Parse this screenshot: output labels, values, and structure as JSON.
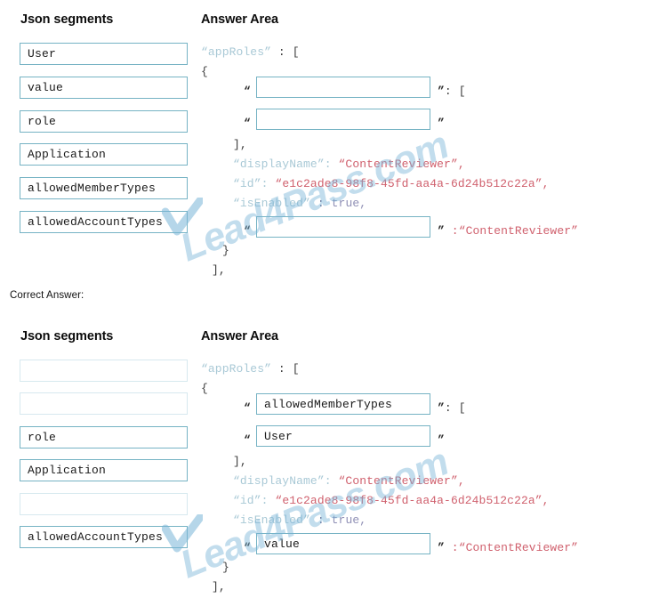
{
  "watermark": {
    "text": "Lead4Pass.com"
  },
  "question_panel": {
    "segments_heading": "Json segments",
    "answer_heading": "Answer Area",
    "segments": [
      {
        "label": "User",
        "used": false
      },
      {
        "label": "value",
        "used": false
      },
      {
        "label": "role",
        "used": false
      },
      {
        "label": "Application",
        "used": false
      },
      {
        "label": "allowedMemberTypes",
        "used": false
      },
      {
        "label": "allowedAccountTypes",
        "used": false
      }
    ],
    "code": {
      "line_approles_key": "“appRoles”",
      "line_approles_rest": " : [",
      "line_open_brace": "{",
      "quote_left_1": "“",
      "quote_right_1": "”",
      "after_quote_1": ": [",
      "quote_left_2": "“",
      "quote_right_2": "”",
      "line_close_array": "],",
      "displayname_key": "“displayName”:",
      "displayname_value": "“ContentReviewer”,",
      "id_key": "“id”:",
      "id_value": "“e1c2ade8-98f8-45fd-aa4a-6d24b512c22a”,",
      "isenabled_key": "“isEnabled”",
      "isenabled_colon": " : ",
      "isenabled_value": "true,",
      "quote_left_3": "“",
      "quote_right_3": "”",
      "value_tail": " :“ContentReviewer”",
      "line_close_brace": "}",
      "line_close_outer": "],"
    },
    "drop_boxes": [
      {
        "value": ""
      },
      {
        "value": ""
      },
      {
        "value": ""
      }
    ]
  },
  "answer_panel": {
    "correct_answer_label": "Correct Answer:",
    "segments_heading": "Json segments",
    "answer_heading": "Answer Area",
    "segments": [
      {
        "label": "",
        "used": true
      },
      {
        "label": "",
        "used": true
      },
      {
        "label": "role",
        "used": false
      },
      {
        "label": "Application",
        "used": false
      },
      {
        "label": "",
        "used": true
      },
      {
        "label": "allowedAccountTypes",
        "used": false
      }
    ],
    "code": {
      "line_approles_key": "“appRoles”",
      "line_approles_rest": " : [",
      "line_open_brace": "{",
      "quote_left_1": "“",
      "quote_right_1": "”",
      "after_quote_1": ": [",
      "quote_left_2": "“",
      "quote_right_2": "”",
      "line_close_array": "],",
      "displayname_key": "“displayName”:",
      "displayname_value": "“ContentReviewer”,",
      "id_key": "“id”:",
      "id_value": "“e1c2ade8-98f8-45fd-aa4a-6d24b512c22a”,",
      "isenabled_key": "“isEnabled”",
      "isenabled_colon": " : ",
      "isenabled_value": "true,",
      "quote_left_3": "“",
      "quote_right_3": "”",
      "value_tail": " :“ContentReviewer”",
      "line_close_brace": "}",
      "line_close_outer": "],"
    },
    "drop_boxes": [
      {
        "value": "allowedMemberTypes"
      },
      {
        "value": "User"
      },
      {
        "value": "value"
      }
    ]
  }
}
